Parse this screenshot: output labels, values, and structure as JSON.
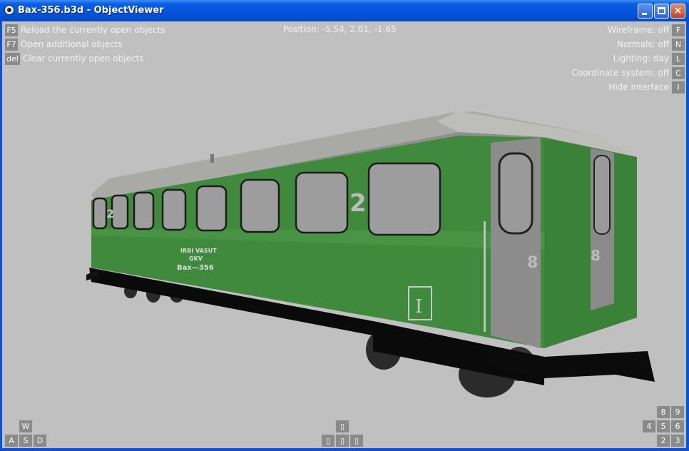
{
  "window": {
    "title": "Bax-356.b3d - ObjectViewer"
  },
  "hud": {
    "left": [
      {
        "key": "F5",
        "label": "Reload the currently open objects"
      },
      {
        "key": "F7",
        "label": "Open additional objects"
      },
      {
        "key": "del",
        "label": "Clear currently open objects"
      }
    ],
    "position": "Position: -5.54, 2.01, -1.65",
    "right": [
      {
        "label": "Wireframe: off",
        "key": "F"
      },
      {
        "label": "Normals: off",
        "key": "N"
      },
      {
        "label": "Lighting: day",
        "key": "L"
      },
      {
        "label": "Coordinate system: off",
        "key": "C"
      },
      {
        "label": "Hide interface",
        "key": "I"
      }
    ]
  },
  "nav": {
    "wasd": [
      "W",
      "A",
      "S",
      "D"
    ],
    "arrows": [
      "▯",
      "▯",
      "▯",
      "▯"
    ],
    "numpad": [
      "8",
      "9",
      "4",
      "5",
      "6",
      "2",
      "3"
    ]
  },
  "train": {
    "class_number_1": "2",
    "class_number_2": "2",
    "door_number_1": "8",
    "door_number_2": "8",
    "class_sign": "I",
    "owner": "IRBI VASUT",
    "operator": "GKV",
    "car_code": "Bax—356"
  },
  "colors": {
    "background": "#c0c0c0",
    "car_green": "#3f8a3c",
    "door_gray": "#8a8a8a",
    "roof": "#b5b5b2"
  }
}
